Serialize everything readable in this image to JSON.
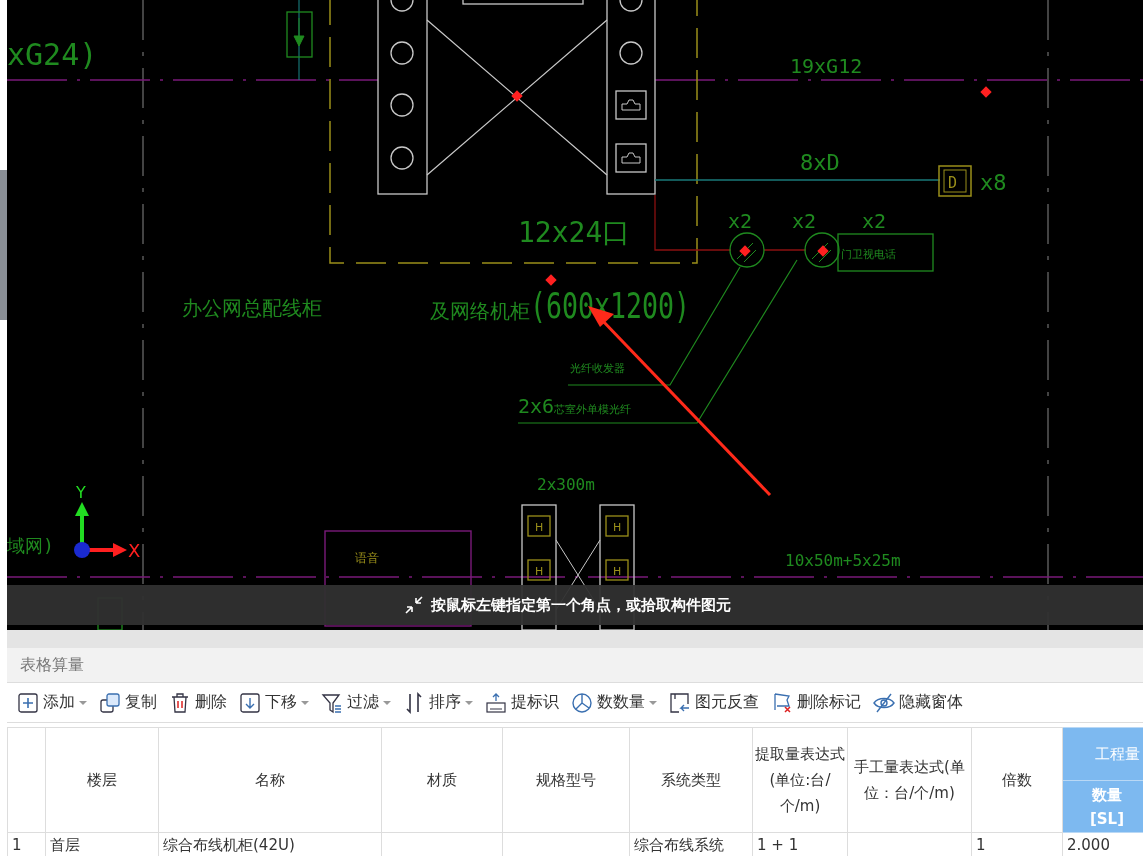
{
  "cad_canvas": {
    "labels": [
      {
        "text": "xG24)"
      },
      {
        "text": "19xG12"
      },
      {
        "text": "8xD"
      },
      {
        "text": "x8"
      },
      {
        "text": "x2"
      },
      {
        "text": "x2"
      },
      {
        "text": "x2"
      },
      {
        "text": "门卫视电话"
      },
      {
        "text": "12x24口"
      },
      {
        "text": "办公网总配线柜"
      },
      {
        "text": "及网络机柜(600x1200)"
      },
      {
        "text": "光纤收发器"
      },
      {
        "text": "2x6芯室外单模光纤"
      },
      {
        "text": "2x300m"
      },
      {
        "text": "域网)"
      },
      {
        "text": "语音"
      },
      {
        "text": "10x50m+5x25m"
      }
    ],
    "symbols": {
      "d_outlet": "D",
      "sockets": [
        "H",
        "H",
        "H",
        "H"
      ]
    },
    "axes": {
      "x_label": "X",
      "y_label": "Y"
    },
    "command_hint": "按鼠标左键指定第一个角点，或拾取构件图元"
  },
  "panel": {
    "title": "表格算量"
  },
  "toolbar": [
    {
      "label": "添加",
      "has_menu": true
    },
    {
      "label": "复制",
      "has_menu": false
    },
    {
      "label": "删除",
      "has_menu": false
    },
    {
      "label": "下移",
      "has_menu": true
    },
    {
      "label": "过滤",
      "has_menu": true
    },
    {
      "label": "排序",
      "has_menu": true
    },
    {
      "label": "提标识",
      "has_menu": false
    },
    {
      "label": "数数量",
      "has_menu": true
    },
    {
      "label": "图元反查",
      "has_menu": false
    },
    {
      "label": "删除标记",
      "has_menu": false
    },
    {
      "label": "隐藏窗体",
      "has_menu": false
    }
  ],
  "table": {
    "columns": [
      "楼层",
      "名称",
      "材质",
      "规格型号",
      "系统类型",
      "提取量表达式(单位:台/个/m)",
      "手工量表达式(单位：台/个/m)",
      "倍数"
    ],
    "group_header": "工程量",
    "group_columns": [
      "数量[SL]"
    ],
    "rows": [
      {
        "number": "1",
        "cells": [
          "首层",
          "综合布线机柜(42U)",
          "",
          "",
          "综合布线系统",
          "1 + 1",
          "",
          "1",
          "2.000"
        ]
      }
    ]
  }
}
